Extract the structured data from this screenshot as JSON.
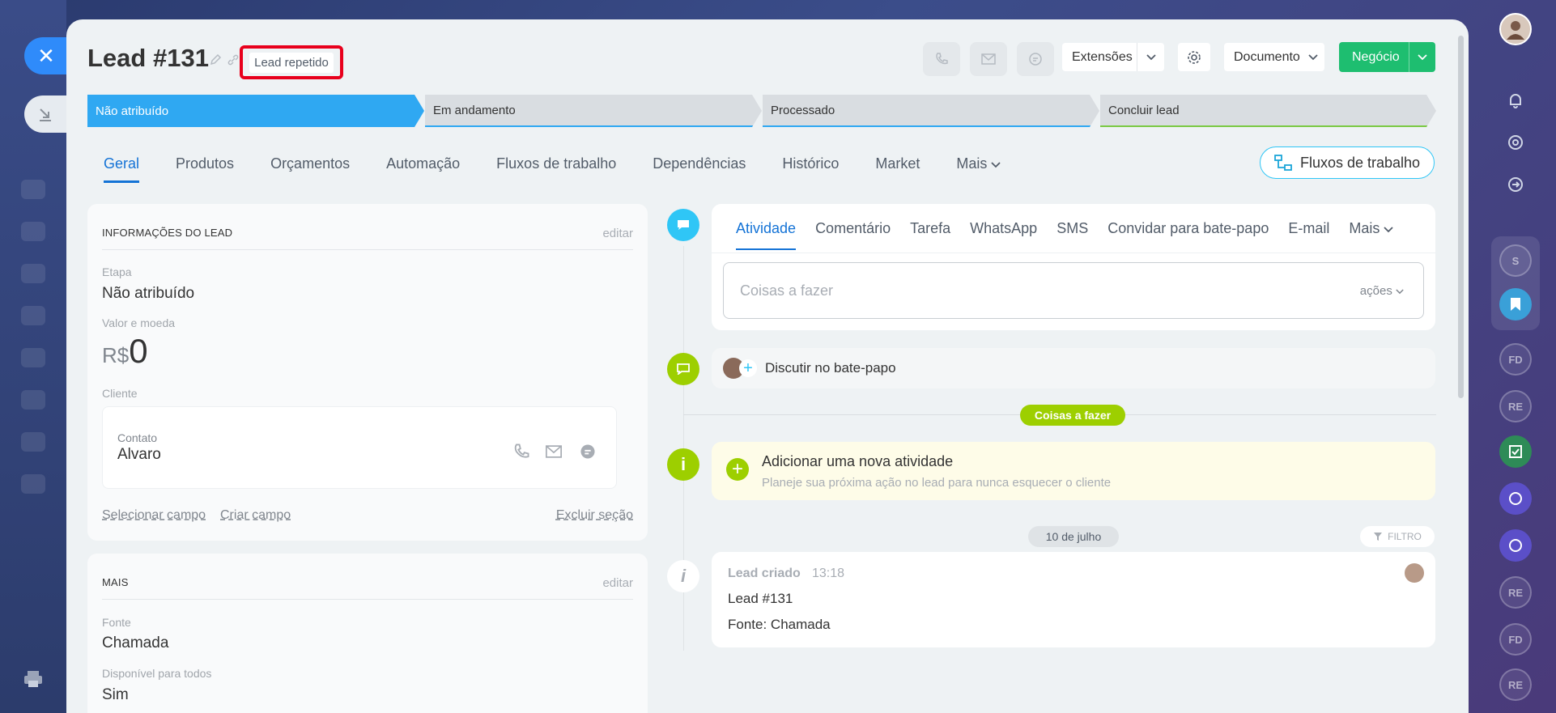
{
  "colors": {
    "primary": "#2fa8f2",
    "accent_green": "#1ebe70",
    "link_blue": "#1473d6",
    "badge_red": "#e8001c"
  },
  "lead": {
    "title": "Lead #131",
    "badge": "Lead repetido"
  },
  "header": {
    "extensions_label": "Extensões",
    "document_label": "Documento",
    "deal_label": "Negócio"
  },
  "stages": [
    "Não atribuído",
    "Em andamento",
    "Processado",
    "Concluir lead"
  ],
  "tabs": [
    "Geral",
    "Produtos",
    "Orçamentos",
    "Automação",
    "Fluxos de trabalho",
    "Dependências",
    "Histórico",
    "Market",
    "Mais"
  ],
  "flows_button": "Fluxos de trabalho",
  "info_card": {
    "title": "INFORMAÇÕES DO LEAD",
    "edit": "editar",
    "stage_label": "Etapa",
    "stage_value": "Não atribuído",
    "amount_label": "Valor e moeda",
    "currency": "R$",
    "amount": "0",
    "client_label": "Cliente",
    "contact_label": "Contato",
    "contact_name": "Alvaro",
    "select_field": "Selecionar campo",
    "create_field": "Criar campo",
    "delete_section": "Excluir seção"
  },
  "more_card": {
    "title": "MAIS",
    "edit": "editar",
    "source_label": "Fonte",
    "source_value": "Chamada",
    "available_label": "Disponível para todos",
    "available_value": "Sim"
  },
  "activity": {
    "tabs": [
      "Atividade",
      "Comentário",
      "Tarefa",
      "WhatsApp",
      "SMS",
      "Convidar para bate-papo",
      "E-mail",
      "Mais"
    ],
    "input_placeholder": "Coisas a fazer",
    "actions_label": "ações",
    "discuss_label": "Discutir no bate-papo",
    "todo_pill": "Coisas a fazer",
    "add_title": "Adicionar uma nova atividade",
    "add_subtitle": "Planeje sua próxima ação no lead para nunca esquecer o cliente",
    "date_pill": "10 de julho",
    "filter_label": "FILTRO",
    "event_title": "Lead criado",
    "event_time": "13:18",
    "event_line1": "Lead #131",
    "event_line2": "Fonte: Chamada"
  },
  "right_bar": [
    "S",
    "FD",
    "RE",
    "RE",
    "FD",
    "RE"
  ]
}
